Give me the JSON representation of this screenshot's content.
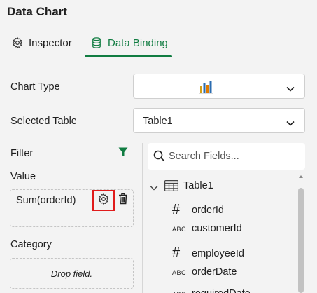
{
  "panel": {
    "title": "Data Chart"
  },
  "tabs": [
    {
      "label": "Inspector",
      "icon": "gear-icon"
    },
    {
      "label": "Data Binding",
      "icon": "database-icon",
      "active": true
    }
  ],
  "chart_type": {
    "label": "Chart Type",
    "value_icon": "bar-chart-icon"
  },
  "selected_table": {
    "label": "Selected Table",
    "value": "Table1"
  },
  "filter": {
    "label": "Filter",
    "icon": "filter-icon"
  },
  "value_section": {
    "label": "Value",
    "item": "Sum(orderId)"
  },
  "category_section": {
    "label": "Category",
    "placeholder": "Drop field."
  },
  "search": {
    "placeholder": "Search Fields..."
  },
  "tree": {
    "table": "Table1",
    "fields": [
      {
        "type": "#",
        "name": "orderId"
      },
      {
        "type": "ABC",
        "name": "customerId"
      },
      {
        "type": "#",
        "name": "employeeId"
      },
      {
        "type": "ABC",
        "name": "orderDate"
      },
      {
        "type": "ABC",
        "name": "requiredDate"
      }
    ]
  },
  "colors": {
    "accent": "#107c41",
    "highlight": "#e01b1b"
  }
}
